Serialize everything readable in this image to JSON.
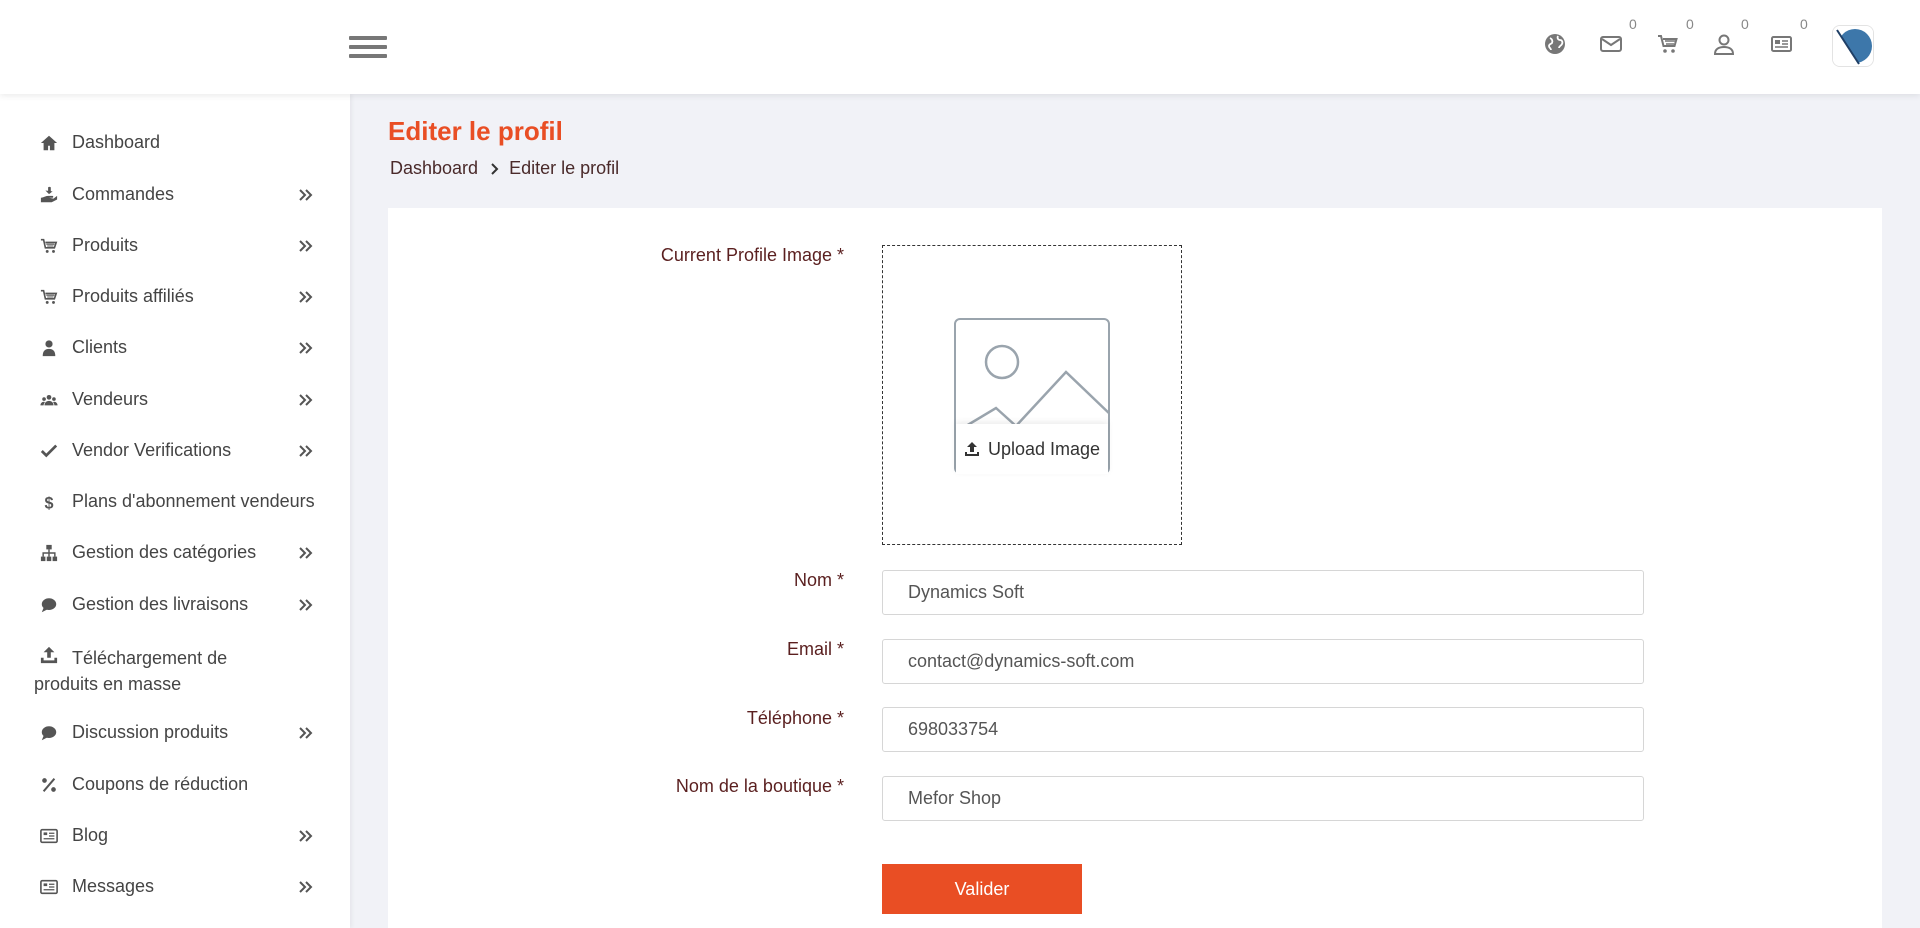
{
  "header": {
    "icons": [
      "globe-icon",
      "mail-icon",
      "cart-icon",
      "user-icon",
      "newspaper-icon"
    ],
    "badges": {
      "mail": "0",
      "cart": "0",
      "user": "0",
      "news": "0"
    }
  },
  "sidebar": {
    "items": [
      {
        "label": "Dashboard",
        "icon": "home-icon",
        "has_children": false
      },
      {
        "label": "Commandes",
        "icon": "hand-holding-icon",
        "has_children": true
      },
      {
        "label": "Produits",
        "icon": "cart-icon",
        "has_children": true
      },
      {
        "label": "Produits affiliés",
        "icon": "cart-icon",
        "has_children": true
      },
      {
        "label": "Clients",
        "icon": "user-icon",
        "has_children": true
      },
      {
        "label": "Vendeurs",
        "icon": "users-icon",
        "has_children": true
      },
      {
        "label": "Vendor Verifications",
        "icon": "check-icon",
        "has_children": true
      },
      {
        "label": "Plans d'abonnement vendeurs",
        "icon": "dollar-icon",
        "has_children": false
      },
      {
        "label": "Gestion des catégories",
        "icon": "sitemap-icon",
        "has_children": true
      },
      {
        "label": "Gestion des livraisons",
        "icon": "comment-icon",
        "has_children": true
      },
      {
        "label": "Téléchargement de",
        "label_line2": "produits en masse",
        "icon": "upload-icon",
        "has_children": false
      },
      {
        "label": "Discussion produits",
        "icon": "comment-icon",
        "has_children": true
      },
      {
        "label": "Coupons de réduction",
        "icon": "percent-icon",
        "has_children": false
      },
      {
        "label": "Blog",
        "icon": "newspaper-icon",
        "has_children": true
      },
      {
        "label": "Messages",
        "icon": "newspaper-icon",
        "has_children": true
      }
    ]
  },
  "page": {
    "title": "Editer le profil",
    "breadcrumb": [
      "Dashboard",
      "Editer le profil"
    ]
  },
  "form": {
    "profile_image_label": "Current Profile Image *",
    "upload_label": "Upload Image",
    "fields": [
      {
        "label": "Nom *",
        "value": "Dynamics Soft"
      },
      {
        "label": "Email *",
        "value": "contact@dynamics-soft.com"
      },
      {
        "label": "Téléphone *",
        "value": "698033754"
      },
      {
        "label": "Nom de la boutique *",
        "value": "Mefor Shop"
      }
    ],
    "submit_label": "Valider"
  },
  "colors": {
    "accent": "#e94e24",
    "label": "#5a1f1f",
    "background": "#f1f2f7"
  }
}
